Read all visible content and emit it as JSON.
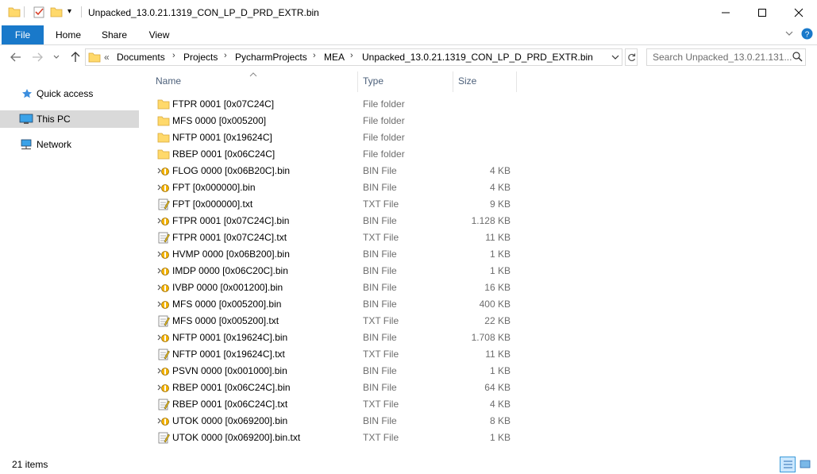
{
  "window": {
    "title": "Unpacked_13.0.21.1319_CON_LP_D_PRD_EXTR.bin",
    "minimize": "—",
    "maximize": "☐",
    "close": "✕"
  },
  "ribbon": {
    "tabs": [
      "File",
      "Home",
      "Share",
      "View"
    ],
    "help_icon": "help-icon",
    "expand_icon": "chevron-down-icon"
  },
  "address": {
    "overflow": "«",
    "crumbs": [
      "Documents",
      "Projects",
      "PycharmProjects",
      "MEA",
      "Unpacked_13.0.21.1319_CON_LP_D_PRD_EXTR.bin"
    ],
    "search_placeholder": "Search Unpacked_13.0.21.131..."
  },
  "nav": {
    "items": [
      {
        "label": "Quick access",
        "icon": "star-icon"
      },
      {
        "label": "This PC",
        "icon": "computer-icon"
      },
      {
        "label": "Network",
        "icon": "network-icon"
      }
    ]
  },
  "columns": {
    "name": "Name",
    "type": "Type",
    "size": "Size"
  },
  "files": [
    {
      "name": "FTPR 0001 [0x07C24C]",
      "type": "File folder",
      "size": "",
      "icon": "folder"
    },
    {
      "name": "MFS 0000 [0x005200]",
      "type": "File folder",
      "size": "",
      "icon": "folder"
    },
    {
      "name": "NFTP 0001 [0x19624C]",
      "type": "File folder",
      "size": "",
      "icon": "folder"
    },
    {
      "name": "RBEP 0001 [0x06C24C]",
      "type": "File folder",
      "size": "",
      "icon": "folder"
    },
    {
      "name": "FLOG 0000 [0x06B20C].bin",
      "type": "BIN File",
      "size": "4 KB",
      "icon": "bin"
    },
    {
      "name": "FPT [0x000000].bin",
      "type": "BIN File",
      "size": "4 KB",
      "icon": "bin"
    },
    {
      "name": "FPT [0x000000].txt",
      "type": "TXT File",
      "size": "9 KB",
      "icon": "txt"
    },
    {
      "name": "FTPR 0001 [0x07C24C].bin",
      "type": "BIN File",
      "size": "1.128 KB",
      "icon": "bin"
    },
    {
      "name": "FTPR 0001 [0x07C24C].txt",
      "type": "TXT File",
      "size": "11 KB",
      "icon": "txt"
    },
    {
      "name": "HVMP 0000 [0x06B200].bin",
      "type": "BIN File",
      "size": "1 KB",
      "icon": "bin"
    },
    {
      "name": "IMDP 0000 [0x06C20C].bin",
      "type": "BIN File",
      "size": "1 KB",
      "icon": "bin"
    },
    {
      "name": "IVBP 0000 [0x001200].bin",
      "type": "BIN File",
      "size": "16 KB",
      "icon": "bin"
    },
    {
      "name": "MFS 0000 [0x005200].bin",
      "type": "BIN File",
      "size": "400 KB",
      "icon": "bin"
    },
    {
      "name": "MFS 0000 [0x005200].txt",
      "type": "TXT File",
      "size": "22 KB",
      "icon": "txt"
    },
    {
      "name": "NFTP 0001 [0x19624C].bin",
      "type": "BIN File",
      "size": "1.708 KB",
      "icon": "bin"
    },
    {
      "name": "NFTP 0001 [0x19624C].txt",
      "type": "TXT File",
      "size": "11 KB",
      "icon": "txt"
    },
    {
      "name": "PSVN 0000 [0x001000].bin",
      "type": "BIN File",
      "size": "1 KB",
      "icon": "bin"
    },
    {
      "name": "RBEP 0001 [0x06C24C].bin",
      "type": "BIN File",
      "size": "64 KB",
      "icon": "bin"
    },
    {
      "name": "RBEP 0001 [0x06C24C].txt",
      "type": "TXT File",
      "size": "4 KB",
      "icon": "txt"
    },
    {
      "name": "UTOK 0000 [0x069200].bin",
      "type": "BIN File",
      "size": "8 KB",
      "icon": "bin"
    },
    {
      "name": "UTOK 0000 [0x069200].bin.txt",
      "type": "TXT File",
      "size": "1 KB",
      "icon": "txt"
    }
  ],
  "status": {
    "item_count": "21 items"
  },
  "colors": {
    "accent": "#1979ca",
    "folder": "#ffd96b",
    "header_text": "#4c607a"
  }
}
